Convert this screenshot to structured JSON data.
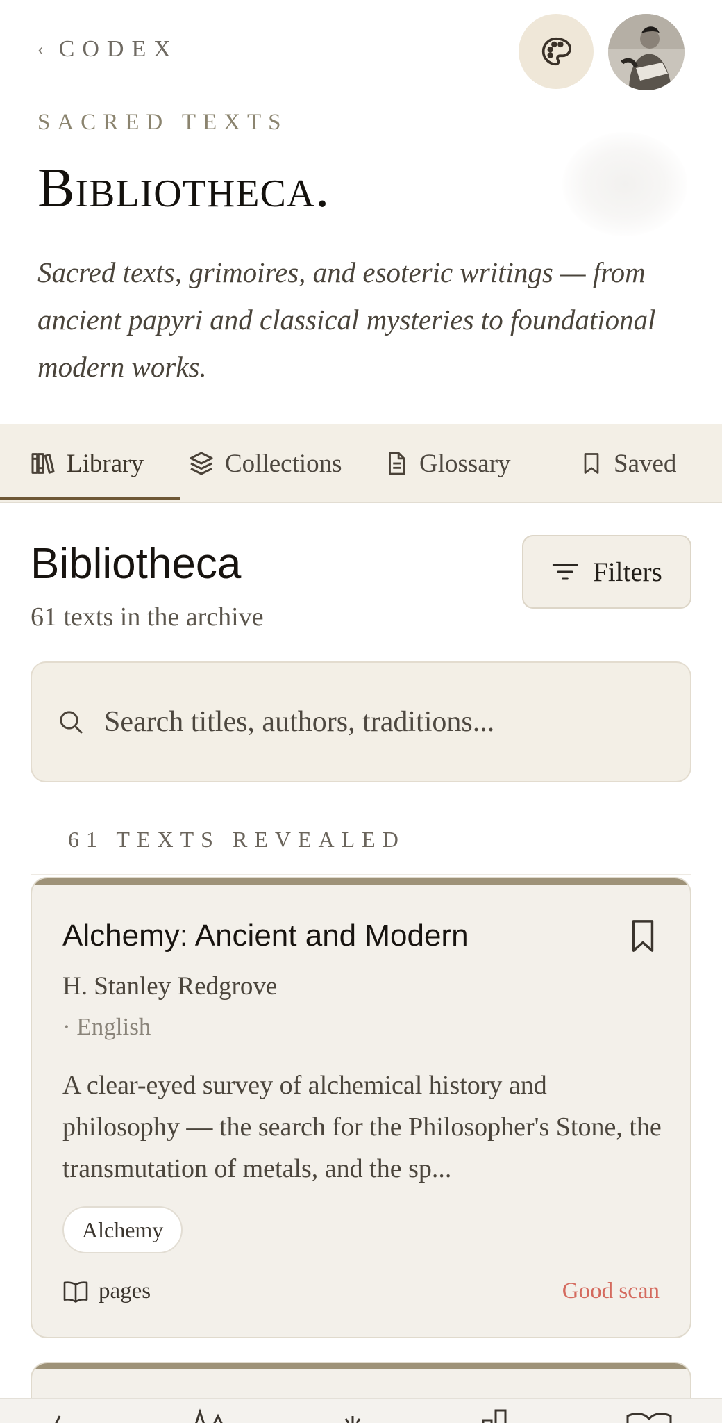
{
  "header": {
    "back_label": "CODEX",
    "back_chevron": "‹",
    "palette_icon": "palette-icon",
    "avatar": "user-avatar"
  },
  "hero": {
    "eyebrow": "SACRED TEXTS",
    "title": "Bibliotheca.",
    "description": "Sacred texts, grimoires, and esoteric writings — from ancient papyri and classical mysteries to foundational modern works."
  },
  "tabs": [
    {
      "label": "Library",
      "icon": "library-icon",
      "active": true
    },
    {
      "label": "Collections",
      "icon": "layers-icon",
      "active": false
    },
    {
      "label": "Glossary",
      "icon": "document-icon",
      "active": false
    },
    {
      "label": "Saved",
      "icon": "bookmark-icon",
      "active": false
    }
  ],
  "section": {
    "title": "Bibliotheca",
    "count": "61 texts in the archive",
    "filters_label": "Filters"
  },
  "search": {
    "placeholder": "Search titles, authors, traditions..."
  },
  "results_label": "61 TEXTS REVEALED",
  "books": [
    {
      "title": "Alchemy: Ancient and Modern",
      "author": "H. Stanley Redgrove",
      "language": "· English",
      "description": "A clear-eyed survey of alchemical history and philosophy — the search for the Philosopher's Stone, the transmutation of metals, and the sp...",
      "tag": "Alchemy",
      "pages_label": "pages",
      "scan_quality": "Good scan"
    }
  ],
  "colors": {
    "accent": "#6e5836",
    "tab_bg": "#f3efe6",
    "card_bg": "#f3f0ea",
    "scan_good": "#d46a5e"
  }
}
